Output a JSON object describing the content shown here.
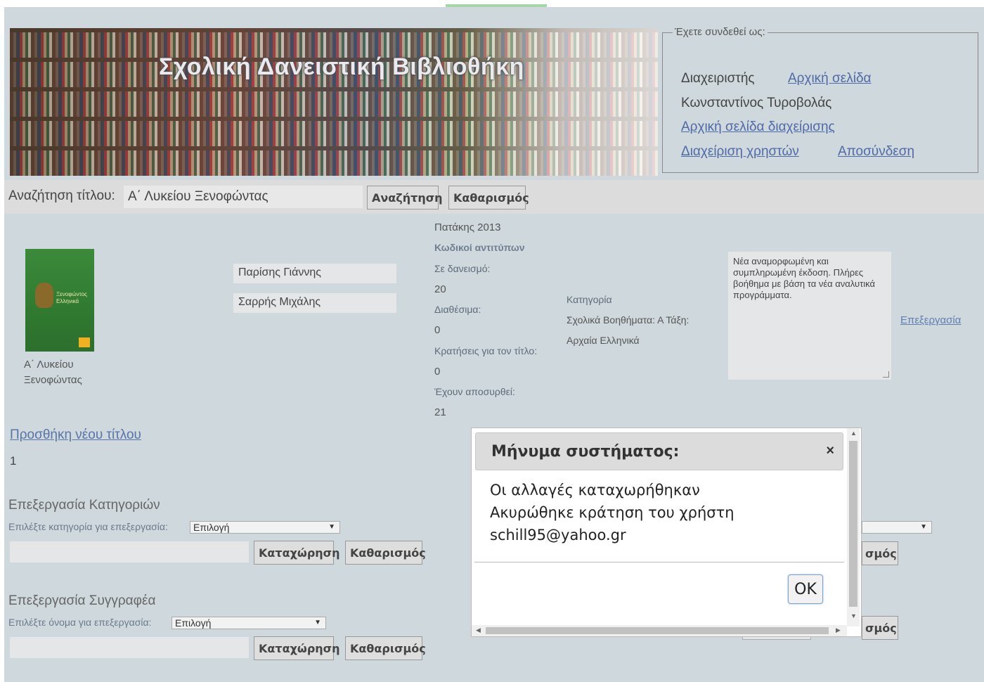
{
  "header": {
    "banner_title": "Σχολική Δανειστική Βιβλιοθήκη"
  },
  "login": {
    "legend": "Έχετε συνδεθεί ως:",
    "role": "Διαχειριστής",
    "home_link": "Αρχική σελίδα",
    "user_name": "Κωνσταντίνος Τυροβολάς",
    "admin_home_link": "Αρχική σελίδα διαχείρισης",
    "manage_users_link": "Διαχείριση χρηστών",
    "logout_link": "Αποσύνδεση"
  },
  "search": {
    "label": "Αναζήτηση τίτλου:",
    "value": "Α΄ Λυκείου Ξενοφώντας",
    "search_button": "Αναζήτηση",
    "clear_button": "Καθαρισμός"
  },
  "result": {
    "cover_text": "Ξενοφώντος Ελληνικά",
    "title_line1": "Α΄ Λυκείου",
    "title_line2": "Ξενοφώντας",
    "authors": [
      "Παρίσης Γιάννης",
      "Σαρρής Μιχάλης"
    ],
    "publisher_year": "Πατάκης 2013",
    "copy_codes_label": "Κωδικοί αντιτύπων",
    "on_loan_label": "Σε δανεισμό:",
    "on_loan_value": "20",
    "available_label": "Διαθέσιμα:",
    "available_value": "0",
    "reservations_label": "Κρατήσεις για τον τίτλο:",
    "reservations_value": "0",
    "withdrawn_label": "Έχουν αποσυρθεί:",
    "withdrawn_value": "21",
    "category_label": "Κατηγορία",
    "category_value1": "Σχολικά Βοηθήματα: Α Τάξη:",
    "category_value2": "Αρχαία Ελληνικά",
    "description": "Νέα αναμορφωμένη και συμπληρωμένη έκδοση. Πλήρες βοήθημα με βάση τα νέα αναλυτικά προγράμματα.",
    "edit_link": "Επεξεργασία"
  },
  "add_title": {
    "link": "Προσθήκη νέου τίτλου",
    "count": "1"
  },
  "categories_section": {
    "title": "Επεξεργασία Κατηγοριών",
    "select_label": "Επιλέξτε κατηγορία για επεξεργασία:",
    "select_value": "Επιλογή",
    "save_button": "Καταχώρηση",
    "clear_button": "Καθαρισμός"
  },
  "author_section": {
    "title": "Επεξεργασία Συγγραφέα",
    "select_label": "Επιλέξτε όνομα για επεξεργασία:",
    "select_value": "Επιλογή",
    "save_button": "Καταχώρηση",
    "clear_button": "Καθαρισμός"
  },
  "right_partial": {
    "clear_fragment_1": "σμός",
    "clear_fragment_2": "σμός"
  },
  "dialog": {
    "title": "Μήνυμα συστήματος:",
    "close": "×",
    "line1": "Οι αλλαγές καταχωρήθηκαν",
    "line2": "Ακυρώθηκε κράτηση του χρήστη",
    "line3": "schill95@yahoo.gr",
    "ok_button": "OK"
  }
}
